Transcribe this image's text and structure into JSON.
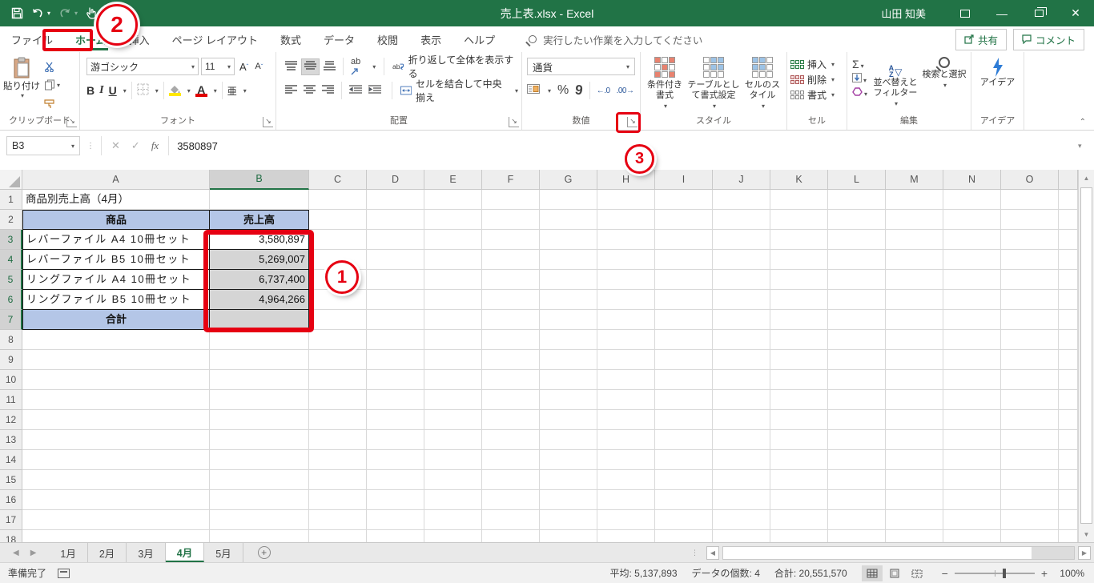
{
  "titlebar": {
    "title": "売上表.xlsx  -  Excel",
    "user": "山田 知美"
  },
  "ribbon_tabs": [
    "ファイル",
    "ホーム",
    "挿入",
    "ページ レイアウト",
    "数式",
    "データ",
    "校閲",
    "表示",
    "ヘルプ"
  ],
  "search": {
    "placeholder": "実行したい作業を入力してください"
  },
  "actions": {
    "share": "共有",
    "comment": "コメント"
  },
  "ribbon": {
    "clipboard": {
      "group_label": "クリップボード",
      "paste_label": "貼り付け"
    },
    "font": {
      "group_label": "フォント",
      "name": "游ゴシック",
      "size": "11",
      "phonetic": "亜"
    },
    "alignment": {
      "group_label": "配置",
      "wrap_label": "折り返して全体を表示する",
      "merge_label": "セルを結合して中央揃え",
      "orient_label": "ab"
    },
    "number": {
      "group_label": "数値",
      "format": "通貨",
      "percent": "%",
      "comma": "9",
      "inc_dec": "←.0",
      "dec_dec": ".00→"
    },
    "styles": {
      "group_label": "スタイル",
      "conditional": "条件付き書式",
      "table_format": "テーブルとして書式設定",
      "cell_styles": "セルのスタイル"
    },
    "cells": {
      "group_label": "セル",
      "insert": "挿入",
      "delete": "削除",
      "format": "書式"
    },
    "editing": {
      "group_label": "編集",
      "sum": "Σ",
      "sort": "並べ替えとフィルター",
      "find": "検索と選択"
    },
    "ideas": {
      "group_label": "アイデア",
      "label": "アイデア"
    }
  },
  "formula_bar": {
    "name_box": "B3",
    "value": "3580897"
  },
  "sheet": {
    "columns": [
      "A",
      "B",
      "C",
      "D",
      "E",
      "F",
      "G",
      "H",
      "I",
      "J",
      "K",
      "L",
      "M",
      "N",
      "O"
    ],
    "visible_rows": 18,
    "selected_column": "B",
    "selected_rows": [
      3,
      4,
      5,
      6,
      7
    ],
    "title_cell": "商品別売上高（4月）",
    "table": {
      "headers": [
        "商品",
        "売上高"
      ],
      "rows": [
        [
          "レバーファイル A4 10冊セット",
          "3,580,897"
        ],
        [
          "レバーファイル B5 10冊セット",
          "5,269,007"
        ],
        [
          "リングファイル A4 10冊セット",
          "6,737,400"
        ],
        [
          "リングファイル B5 10冊セット",
          "4,964,266"
        ]
      ],
      "total_label": "合計",
      "total_value": ""
    }
  },
  "sheet_tabs": {
    "names": [
      "1月",
      "2月",
      "3月",
      "4月",
      "5月"
    ],
    "active": "4月"
  },
  "status_bar": {
    "mode": "準備完了",
    "average": "平均: 5,137,893",
    "count": "データの個数: 4",
    "sum": "合計: 20,551,570",
    "zoom": "100%"
  },
  "annotations": {
    "n1": "1",
    "n2": "2",
    "n3": "3"
  },
  "colors": {
    "excel_green": "#217346",
    "annotation_red": "#e60012",
    "header_blue": "#b4c6e7",
    "selection_gray": "#d5d5d5"
  }
}
